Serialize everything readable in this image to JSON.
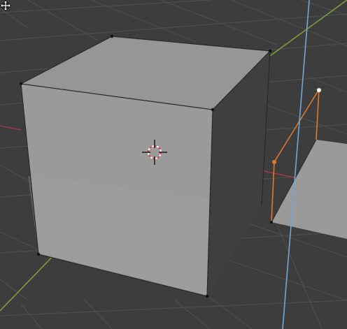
{
  "scene": {
    "background_color": "#3d3d3d",
    "grid_color": "#4a4a4a",
    "x_axis_color": "#9a3a48",
    "y_axis_color": "#7f9a3c",
    "z_axis_color": "#6fa8d8",
    "cube_color": "#9a9a9a",
    "cube_side_color": "#3f3f3f",
    "cube_edge_color": "#2a2a2a",
    "selection_color": "#e0782c",
    "active_vertex_color": "#ffffff",
    "cursor_color": "#e23b3b"
  },
  "icons": {
    "cursor_3d": "3d-cursor-icon",
    "move_cursor": "move-cursor-icon"
  }
}
